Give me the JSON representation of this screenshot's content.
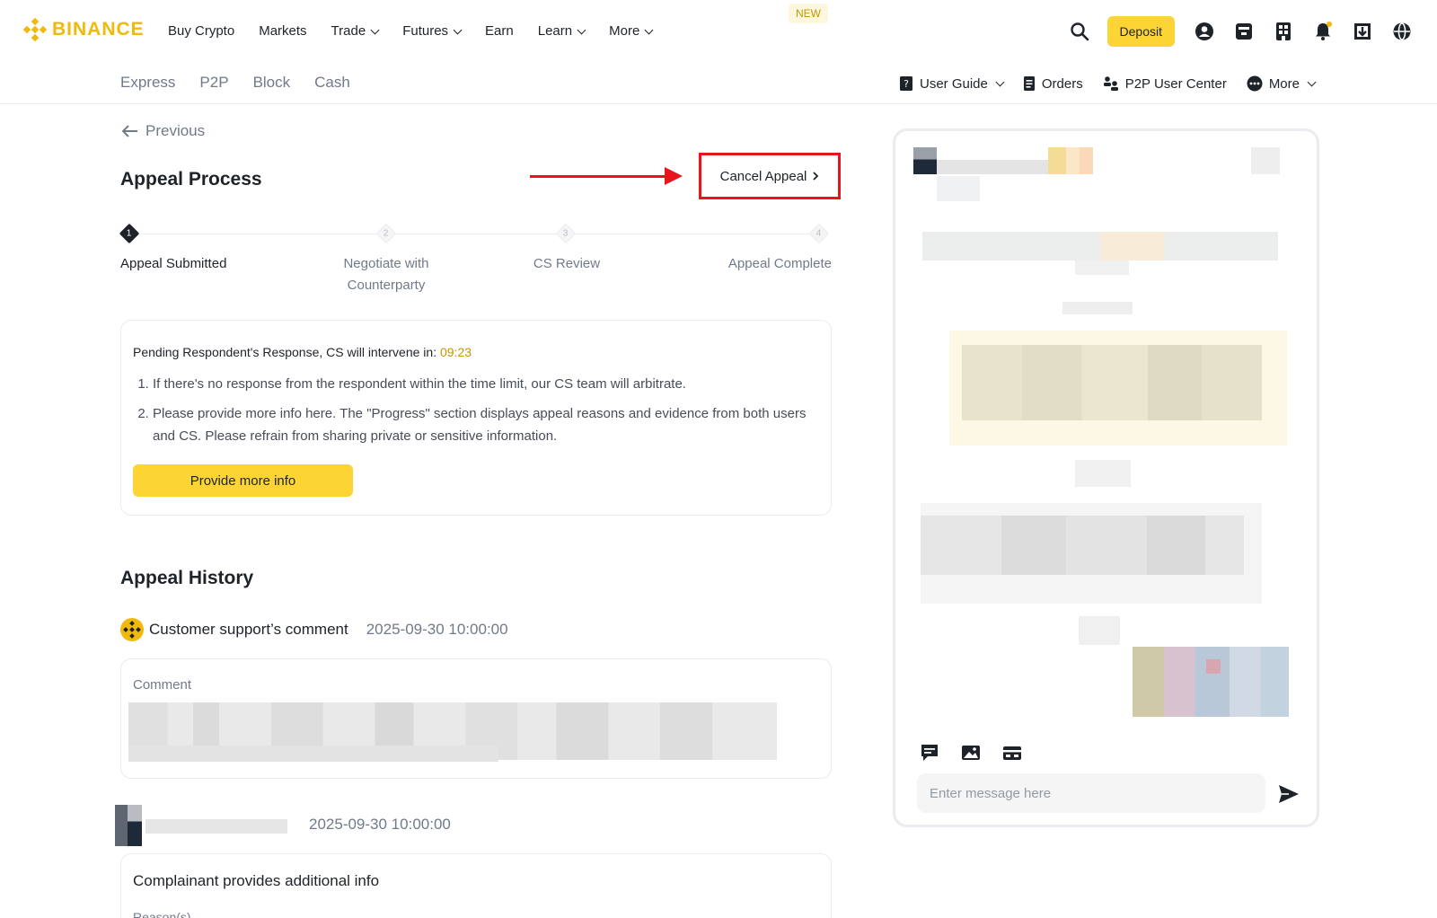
{
  "brand": {
    "name": "BINANCE",
    "color": "#f0b90b"
  },
  "topnav": {
    "items": [
      {
        "label": "Buy Crypto",
        "dropdown": false
      },
      {
        "label": "Markets",
        "dropdown": false
      },
      {
        "label": "Trade",
        "dropdown": true
      },
      {
        "label": "Futures",
        "dropdown": true
      },
      {
        "label": "Earn",
        "dropdown": false
      },
      {
        "label": "Learn",
        "dropdown": true
      },
      {
        "label": "More",
        "dropdown": true
      }
    ],
    "new_badge": "NEW",
    "deposit_label": "Deposit",
    "icons": [
      "search-icon",
      "user-icon",
      "wallet-icon",
      "orders-icon",
      "bell-icon",
      "download-icon",
      "globe-icon"
    ]
  },
  "subnav": {
    "tabs": [
      "Express",
      "P2P",
      "Block",
      "Cash"
    ],
    "right": {
      "user_guide": "User Guide",
      "orders": "Orders",
      "user_center": "P2P User Center",
      "more": "More"
    }
  },
  "page": {
    "previous": "Previous",
    "title": "Appeal Process",
    "cancel_appeal": "Cancel Appeal",
    "steps": [
      {
        "num": "1",
        "label": "Appeal Submitted",
        "active": true
      },
      {
        "num": "2",
        "label": "Negotiate with Counterparty",
        "active": false
      },
      {
        "num": "3",
        "label": "CS Review",
        "active": false
      },
      {
        "num": "4",
        "label": "Appeal Complete",
        "active": false
      }
    ],
    "pending": {
      "text": "Pending Respondent's Response, CS will intervene in: ",
      "countdown": "09:23",
      "notes": [
        "If there's no response from the respondent within the time limit, our CS team will arbitrate.",
        "Please provide more info here. The \"Progress\" section displays appeal reasons and evidence from both users and CS. Please refrain from sharing private or sensitive information."
      ],
      "button": "Provide more info"
    },
    "history": {
      "title": "Appeal History",
      "cs_comment_label": "Customer support’s comment",
      "cs_time": "2025-09-30 10:00:00",
      "comment_label": "Comment",
      "user_time": "2025-09-30 10:00:00",
      "add_title": "Complainant provides additional info",
      "reason_label": "Reason(s)"
    }
  },
  "chat": {
    "placeholder": "Enter message here"
  }
}
